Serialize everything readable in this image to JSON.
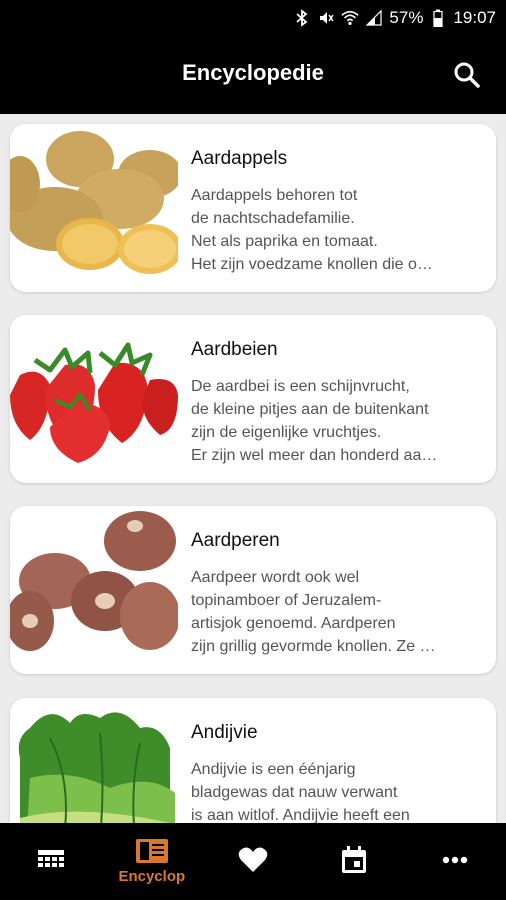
{
  "status_bar": {
    "battery_percent": "57%",
    "time": "19:07"
  },
  "app_bar": {
    "title": "Encyclopedie",
    "search_icon": "search-icon"
  },
  "items": [
    {
      "title": "Aardappels",
      "description": "Aardappels behoren tot\nde nachtschadefamilie.\nNet als paprika en tomaat.\nHet zijn voedzame knollen die o…"
    },
    {
      "title": "Aardbeien",
      "description": "De aardbei is een schijnvrucht,\nde kleine pitjes aan de buitenkant\nzijn de eigenlijke vruchtjes.\nEr zijn wel meer dan honderd aa…"
    },
    {
      "title": "Aardperen",
      "description": "Aardpeer wordt ook wel\ntopinamboer of Jeruzalem-\nartisjok genoemd. Aardperen\nzijn grillig gevormde knollen. Ze …"
    },
    {
      "title": "Andijvie",
      "description": "Andijvie is een éénjarig\nbladgewas dat nauw verwant\nis aan witlof. Andijvie heeft een"
    }
  ],
  "bottom_nav": {
    "items": [
      {
        "icon": "calendar-grid-icon",
        "label": ""
      },
      {
        "icon": "book-icon",
        "label": "Encyclop"
      },
      {
        "icon": "heart-icon",
        "label": ""
      },
      {
        "icon": "calendar-icon",
        "label": ""
      },
      {
        "icon": "more-icon",
        "label": ""
      }
    ],
    "active_color": "#d9782c"
  }
}
